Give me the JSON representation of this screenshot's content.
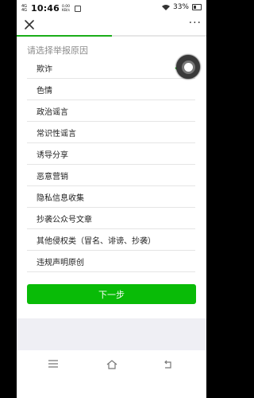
{
  "status_bar": {
    "network": "4G 4G",
    "time": "10:46",
    "speed": "0.00 KB/s",
    "battery_percent": "33%",
    "battery_level": 0.33
  },
  "nav": {
    "more": "···"
  },
  "progress": 0.5,
  "report": {
    "prompt": "请选择举报原因",
    "selected_index": 0,
    "reasons": [
      "欺诈",
      "色情",
      "政治谣言",
      "常识性谣言",
      "诱导分享",
      "恶意营销",
      "隐私信息收集",
      "抄袭公众号文章",
      "其他侵权类（冒名、诽谤、抄袭）",
      "违规声明原创"
    ],
    "next_label": "下一步"
  },
  "colors": {
    "accent": "#1aad19",
    "button": "#09bb07"
  }
}
